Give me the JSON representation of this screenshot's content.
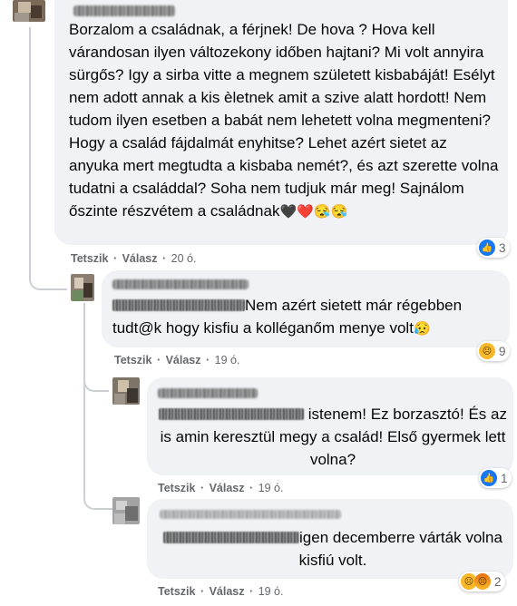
{
  "comments": [
    {
      "text": "Borzalom a családnak, a férjnek! De hova ? Hova kell várandosan ilyen változekony időben hajtani? Mi volt annyira sürgős? Igy a sirba vitte a megnem született kisbabáját! Esélyt nem adott annak a kis èletnek amit a szive alatt hordott! Nem tudom ilyen esetben a babát nem lehetett volna megmenteni? Hogy a család fájdalmát enyhitse? Lehet azért sietet az anyuka mert megtudta a kisbaba nemét?, és azt szerette volna tudatni a családdal? Soha nem tudjuk már meg! Sajnálom őszinte részvétem a családnak",
      "emojis": "🖤❤️😪😪",
      "like": "Tetszik",
      "reply": "Válasz",
      "time": "20 ó.",
      "reaction_count": "3",
      "reaction_icons": [
        "like-icon"
      ]
    },
    {
      "text": "Nem azért sietett már régebben tudt@k hogy kisfiu a kolléganőm menye volt",
      "emojis": "😥",
      "like": "Tetszik",
      "reply": "Válasz",
      "time": "19 ó.",
      "reaction_count": "9",
      "reaction_icons": [
        "sad-icon"
      ]
    },
    {
      "text": "istenem! Ez borzasztó! És az is amin keresztül megy a család! Első gyermek lett volna?",
      "like": "Tetszik",
      "reply": "Válasz",
      "time": "19 ó.",
      "reaction_count": "1",
      "reaction_icons": [
        "like-icon"
      ]
    },
    {
      "text": "igen decemberre várták volna kisfiú volt.",
      "like": "Tetszik",
      "reply": "Válasz",
      "time": "19 ó.",
      "reaction_count": "2",
      "reaction_icons": [
        "sad-icon",
        "angry-icon"
      ]
    }
  ],
  "separator": "·",
  "colors": {
    "bubble": "#f0f2f5",
    "meta": "#65676b",
    "like_blue": "#1877f2",
    "sad_yellow": "#f7b928",
    "thread_line": "#ccd0d5"
  }
}
